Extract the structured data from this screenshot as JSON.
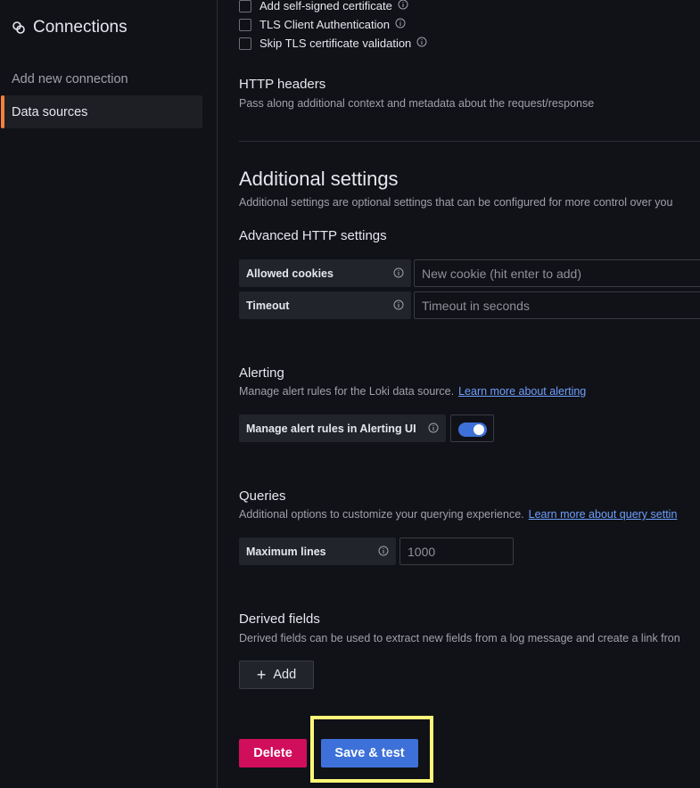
{
  "sidebar": {
    "title": "Connections",
    "items": [
      {
        "label": "Add new connection"
      },
      {
        "label": "Data sources"
      }
    ]
  },
  "tls": {
    "options": [
      {
        "label": "Add self-signed certificate"
      },
      {
        "label": "TLS Client Authentication"
      },
      {
        "label": "Skip TLS certificate validation"
      }
    ]
  },
  "http_headers": {
    "title": "HTTP headers",
    "description": "Pass along additional context and metadata about the request/response"
  },
  "additional_settings": {
    "title": "Additional settings",
    "description": "Additional settings are optional settings that can be configured for more control over you",
    "advanced_http_title": "Advanced HTTP settings",
    "allowed_cookies_label": "Allowed cookies",
    "allowed_cookies_placeholder": "New cookie (hit enter to add)",
    "timeout_label": "Timeout",
    "timeout_placeholder": "Timeout in seconds"
  },
  "alerting": {
    "title": "Alerting",
    "description": "Manage alert rules for the Loki data source.",
    "link": "Learn more about alerting",
    "toggle_label": "Manage alert rules in Alerting UI",
    "toggle_on": true
  },
  "queries": {
    "title": "Queries",
    "description": "Additional options to customize your querying experience.",
    "link": "Learn more about query settin",
    "max_lines_label": "Maximum lines",
    "max_lines_placeholder": "1000"
  },
  "derived_fields": {
    "title": "Derived fields",
    "description": "Derived fields can be used to extract new fields from a log message and create a link fron",
    "add_label": "Add"
  },
  "actions": {
    "delete_label": "Delete",
    "save_label": "Save & test"
  },
  "colors": {
    "background": "#111217",
    "accent_orange": "#f5813f",
    "primary_blue": "#3d71d9",
    "danger": "#d10e5c",
    "highlight": "#fff67a"
  }
}
